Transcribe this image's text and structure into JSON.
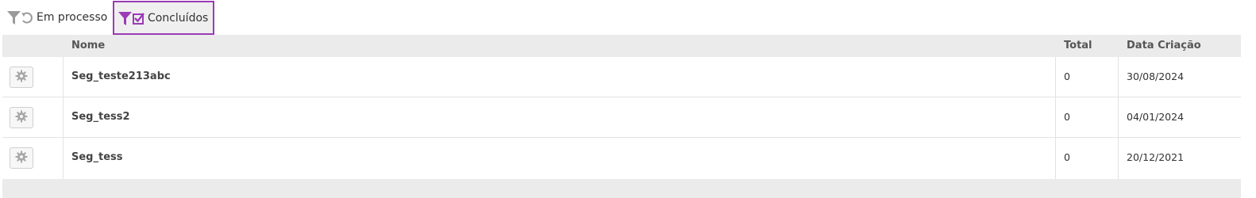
{
  "tabs": [
    {
      "label": "Em processo",
      "icon": "filter-refresh-icon",
      "active": false
    },
    {
      "label": "Concluídos",
      "icon": "filter-check-icon",
      "active": true
    }
  ],
  "table": {
    "headers": {
      "name": "Nome",
      "total": "Total",
      "date": "Data Criação"
    },
    "rows": [
      {
        "name": "Seg_teste213abc",
        "total": "0",
        "date": "30/08/2024"
      },
      {
        "name": "Seg_tess2",
        "total": "0",
        "date": "04/01/2024"
      },
      {
        "name": "Seg_tess",
        "total": "0",
        "date": "20/12/2021"
      }
    ]
  },
  "colors": {
    "accent": "#9b3bb5",
    "header_bg": "#ebebeb",
    "icon_gray": "#9a9a9a"
  }
}
